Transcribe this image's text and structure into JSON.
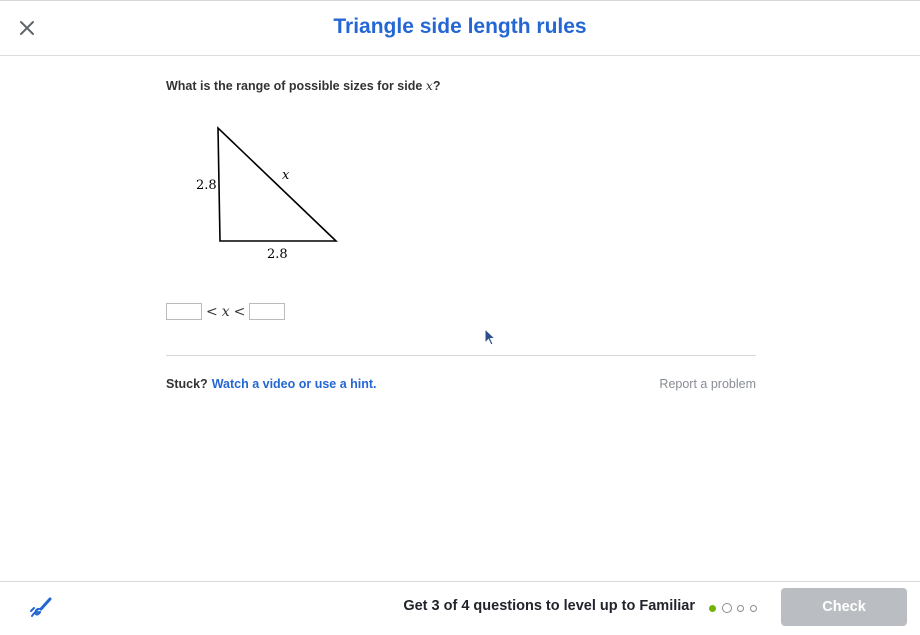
{
  "header": {
    "title": "Triangle side length rules"
  },
  "question": {
    "prefix": "What is the range of possible sizes for side ",
    "variable": "x",
    "suffix": "?"
  },
  "figure": {
    "left_side_label": "2.8",
    "bottom_side_label": "2.8",
    "hypotenuse_label": "x"
  },
  "answer": {
    "lower_value": "",
    "upper_value": "",
    "op1": "<",
    "variable": "x",
    "op2": "<"
  },
  "help": {
    "stuck_label": "Stuck?",
    "hint_link": "Watch a video or use a hint.",
    "report_link": "Report a problem"
  },
  "footer": {
    "progress_text": "Get 3 of 4 questions to level up to Familiar",
    "progress_dots": [
      "filled",
      "current",
      "empty",
      "empty"
    ],
    "check_label": "Check"
  },
  "colors": {
    "accent": "#2467d4",
    "progress_complete": "#71b307",
    "check_disabled": "#babec2"
  }
}
